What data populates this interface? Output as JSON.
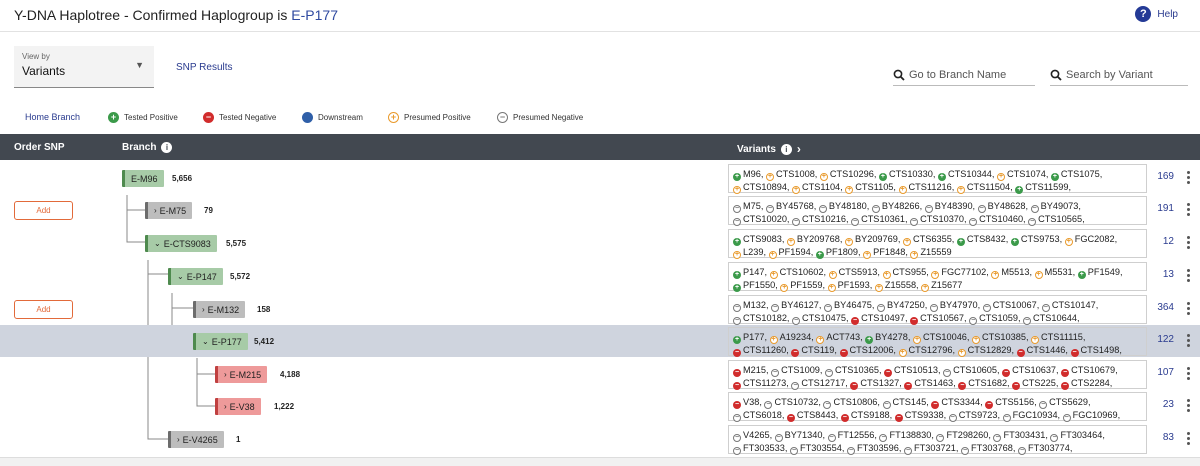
{
  "header": {
    "title_prefix": "Y-DNA Haplotree - Confirmed Haplogroup is ",
    "haplogroup": "E-P177",
    "help_label": "Help"
  },
  "controls": {
    "view_by_label": "View by",
    "view_by_value": "Variants",
    "snp_results": "SNP Results",
    "branch_search_placeholder": "Go to Branch Name",
    "variant_search_placeholder": "Search by Variant"
  },
  "legend": {
    "home": "Home Branch",
    "tested_positive": "Tested Positive",
    "tested_negative": "Tested Negative",
    "downstream": "Downstream",
    "presumed_positive": "Presumed Positive",
    "presumed_negative": "Presumed Negative"
  },
  "table": {
    "col_order": "Order SNP",
    "col_branch": "Branch",
    "col_variants": "Variants"
  },
  "add_label": "Add",
  "colors": {
    "accent": "#2a3b8f",
    "header_bg": "#424850",
    "selected": "#cfd4de",
    "positive": "#3b9a4a",
    "negative": "#d12c2c",
    "presumed_positive": "#e99a2c"
  },
  "rows": [
    {
      "branch": "E-M96",
      "count": "5,656",
      "style": "green",
      "expanded": true,
      "add": false,
      "selected": false,
      "variant_count": "169",
      "lines": [
        [
          [
            "pos",
            "M96, "
          ],
          [
            "ppos",
            "CTS1008, "
          ],
          [
            "ppos",
            "CTS10296, "
          ],
          [
            "pos",
            "CTS10330, "
          ],
          [
            "pos",
            "CTS10344, "
          ],
          [
            "ppos",
            "CTS1074, "
          ],
          [
            "pos",
            "CTS1075,"
          ]
        ],
        [
          [
            "ppos",
            "CTS10894, "
          ],
          [
            "ppos",
            "CTS1104, "
          ],
          [
            "ppos",
            "CTS1105, "
          ],
          [
            "ppos",
            "CTS11216, "
          ],
          [
            "ppos",
            "CTS11504, "
          ],
          [
            "pos",
            "CTS11599,"
          ]
        ]
      ]
    },
    {
      "branch": "E-M75",
      "count": "79",
      "style": "gray",
      "expanded": false,
      "add": true,
      "selected": false,
      "variant_count": "191",
      "lines": [
        [
          [
            "pneg",
            "M75, "
          ],
          [
            "pneg",
            "BY45768, "
          ],
          [
            "pneg",
            "BY48180, "
          ],
          [
            "pneg",
            "BY48266, "
          ],
          [
            "pneg",
            "BY48390, "
          ],
          [
            "pneg",
            "BY48628, "
          ],
          [
            "pneg",
            "BY49073,"
          ]
        ],
        [
          [
            "pneg",
            "CTS10020, "
          ],
          [
            "pneg",
            "CTS10216, "
          ],
          [
            "pneg",
            "CTS10361, "
          ],
          [
            "pneg",
            "CTS10370, "
          ],
          [
            "pneg",
            "CTS10460, "
          ],
          [
            "pneg",
            "CTS10565,"
          ]
        ]
      ]
    },
    {
      "branch": "E-CTS9083",
      "count": "5,575",
      "style": "green",
      "expanded": true,
      "add": false,
      "selected": false,
      "variant_count": "12",
      "lines": [
        [
          [
            "pos",
            "CTS9083, "
          ],
          [
            "ppos",
            "BY209768, "
          ],
          [
            "ppos",
            "BY209769, "
          ],
          [
            "ppos",
            "CTS6355, "
          ],
          [
            "pos",
            "CTS8432, "
          ],
          [
            "pos",
            "CTS9753, "
          ],
          [
            "ppos",
            "FGC2082,"
          ]
        ],
        [
          [
            "ppos",
            "L239, "
          ],
          [
            "ppos",
            "PF1594, "
          ],
          [
            "pos",
            "PF1809, "
          ],
          [
            "ppos",
            "PF1848, "
          ],
          [
            "ppos",
            "Z15559"
          ]
        ]
      ]
    },
    {
      "branch": "E-P147",
      "count": "5,572",
      "style": "green",
      "expanded": true,
      "add": false,
      "selected": false,
      "variant_count": "13",
      "lines": [
        [
          [
            "pos",
            "P147, "
          ],
          [
            "ppos",
            "CTS10602, "
          ],
          [
            "ppos",
            "CTS5913, "
          ],
          [
            "ppos",
            "CTS955, "
          ],
          [
            "ppos",
            "FGC77102, "
          ],
          [
            "ppos",
            "M5513, "
          ],
          [
            "ppos",
            "M5531, "
          ],
          [
            "pos",
            "PF1549,"
          ]
        ],
        [
          [
            "pos",
            "PF1550, "
          ],
          [
            "ppos",
            "PF1559, "
          ],
          [
            "ppos",
            "PF1593, "
          ],
          [
            "ppos",
            "Z15558, "
          ],
          [
            "ppos",
            "Z15677"
          ]
        ]
      ]
    },
    {
      "branch": "E-M132",
      "count": "158",
      "style": "gray",
      "expanded": false,
      "add": true,
      "selected": false,
      "variant_count": "364",
      "lines": [
        [
          [
            "pneg",
            "M132, "
          ],
          [
            "pneg",
            "BY46127, "
          ],
          [
            "pneg",
            "BY46475, "
          ],
          [
            "pneg",
            "BY47250, "
          ],
          [
            "pneg",
            "BY47970, "
          ],
          [
            "pneg",
            "CTS10067, "
          ],
          [
            "pneg",
            "CTS10147,"
          ]
        ],
        [
          [
            "pneg",
            "CTS10182, "
          ],
          [
            "pneg",
            "CTS10475, "
          ],
          [
            "neg",
            "CTS10497, "
          ],
          [
            "neg",
            "CTS10567, "
          ],
          [
            "pneg",
            "CTS1059, "
          ],
          [
            "pneg",
            "CTS10644,"
          ]
        ]
      ]
    },
    {
      "branch": "E-P177",
      "count": "5,412",
      "style": "green",
      "expanded": true,
      "add": false,
      "selected": true,
      "variant_count": "122",
      "lines": [
        [
          [
            "pos",
            "P177, "
          ],
          [
            "ppos",
            "A19234, "
          ],
          [
            "ppos",
            "ACT743, "
          ],
          [
            "pos",
            "BY4278, "
          ],
          [
            "ppos",
            "CTS10046, "
          ],
          [
            "ppos",
            "CTS10385, "
          ],
          [
            "ppos",
            "CTS11115,"
          ]
        ],
        [
          [
            "neg",
            "CTS11260, "
          ],
          [
            "neg",
            "CTS119, "
          ],
          [
            "neg",
            "CTS12006, "
          ],
          [
            "ppos",
            "CTS12796, "
          ],
          [
            "ppos",
            "CTS12829, "
          ],
          [
            "neg",
            "CTS1446, "
          ],
          [
            "neg",
            "CTS1498,"
          ]
        ]
      ]
    },
    {
      "branch": "E-M215",
      "count": "4,188",
      "style": "red",
      "expanded": false,
      "add": false,
      "selected": false,
      "variant_count": "107",
      "lines": [
        [
          [
            "neg",
            "M215, "
          ],
          [
            "pneg",
            "CTS1009, "
          ],
          [
            "pneg",
            "CTS10365, "
          ],
          [
            "neg",
            "CTS10513, "
          ],
          [
            "pneg",
            "CTS10605, "
          ],
          [
            "neg",
            "CTS10637, "
          ],
          [
            "neg",
            "CTS10679,"
          ]
        ],
        [
          [
            "neg",
            "CTS11273, "
          ],
          [
            "pneg",
            "CTS12717, "
          ],
          [
            "neg",
            "CTS1327, "
          ],
          [
            "neg",
            "CTS1463, "
          ],
          [
            "neg",
            "CTS1682, "
          ],
          [
            "neg",
            "CTS225, "
          ],
          [
            "neg",
            "CTS2284,"
          ]
        ]
      ]
    },
    {
      "branch": "E-V38",
      "count": "1,222",
      "style": "red",
      "expanded": false,
      "add": false,
      "selected": false,
      "variant_count": "23",
      "lines": [
        [
          [
            "neg",
            "V38, "
          ],
          [
            "pneg",
            "CTS10732, "
          ],
          [
            "pneg",
            "CTS10806, "
          ],
          [
            "pneg",
            "CTS145, "
          ],
          [
            "neg",
            "CTS3344, "
          ],
          [
            "neg",
            "CTS5156, "
          ],
          [
            "pneg",
            "CTS5629,"
          ]
        ],
        [
          [
            "pneg",
            "CTS6018, "
          ],
          [
            "neg",
            "CTS8443, "
          ],
          [
            "neg",
            "CTS9188, "
          ],
          [
            "neg",
            "CTS9338, "
          ],
          [
            "pneg",
            "CTS9723, "
          ],
          [
            "pneg",
            "FGC10934, "
          ],
          [
            "pneg",
            "FGC10969,"
          ]
        ]
      ]
    },
    {
      "branch": "E-V4265",
      "count": "1",
      "style": "gray",
      "expanded": false,
      "add": false,
      "selected": false,
      "variant_count": "83",
      "lines": [
        [
          [
            "pneg",
            "V4265, "
          ],
          [
            "pneg",
            "BY71340, "
          ],
          [
            "pneg",
            "FT12556, "
          ],
          [
            "pneg",
            "FT138830, "
          ],
          [
            "pneg",
            "FT298260, "
          ],
          [
            "pneg",
            "FT303431, "
          ],
          [
            "pneg",
            "FT303464,"
          ]
        ],
        [
          [
            "pneg",
            "FT303533, "
          ],
          [
            "pneg",
            "FT303554, "
          ],
          [
            "pneg",
            "FT303596, "
          ],
          [
            "pneg",
            "FT303721, "
          ],
          [
            "pneg",
            "FT303768, "
          ],
          [
            "pneg",
            "FT303774,"
          ]
        ]
      ]
    }
  ]
}
